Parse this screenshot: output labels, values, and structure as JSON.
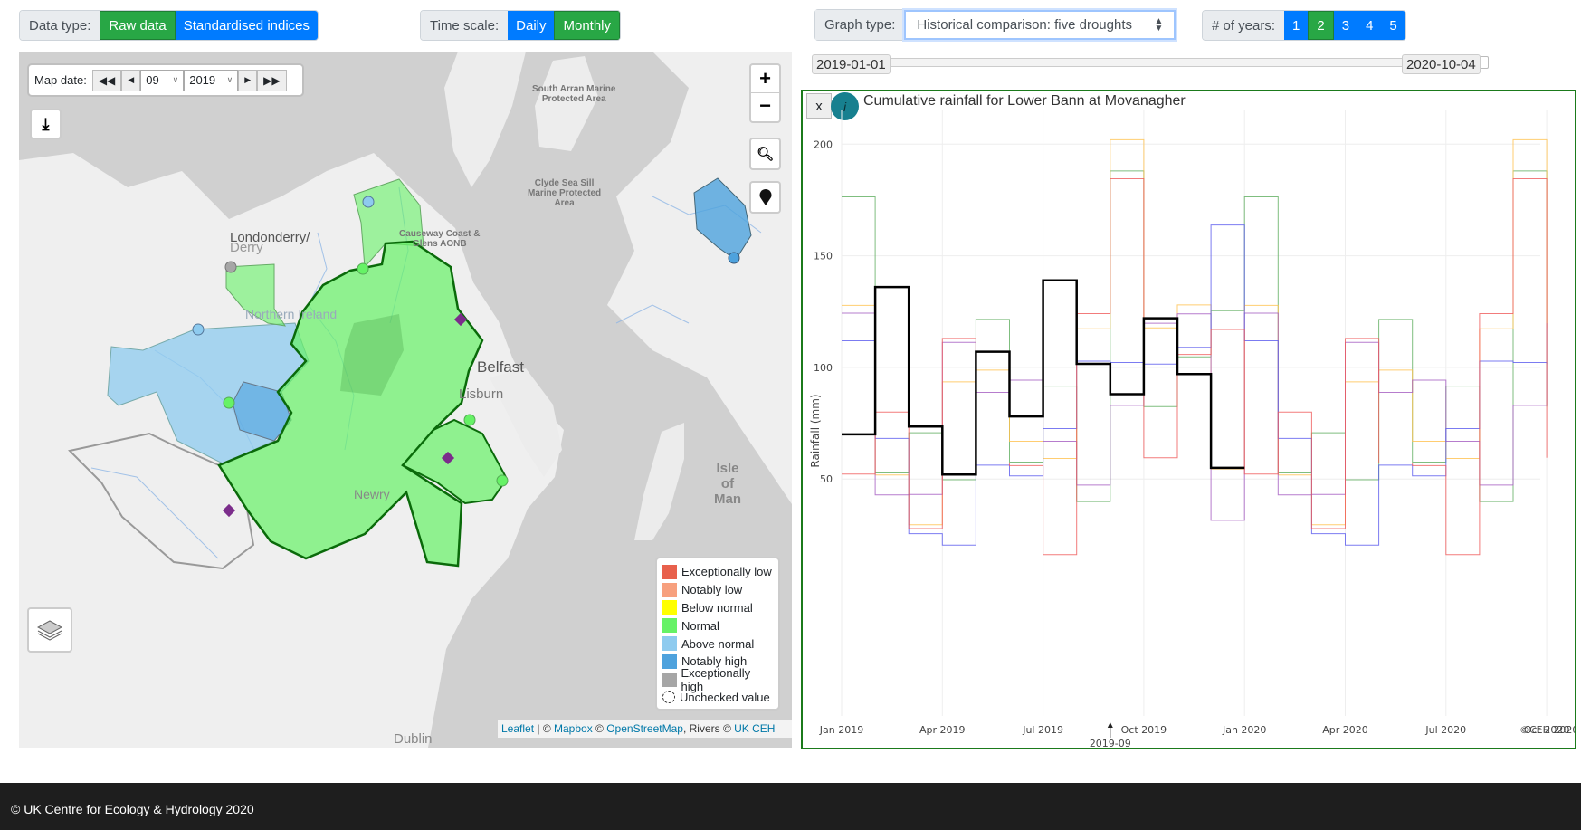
{
  "toolbar": {
    "data_type": {
      "label": "Data type:",
      "options": [
        "Raw data",
        "Standardised indices"
      ],
      "selected": "Raw data"
    },
    "time_scale": {
      "label": "Time scale:",
      "options": [
        "Daily",
        "Monthly"
      ],
      "selected": "Monthly"
    },
    "graph_type": {
      "label": "Graph type:",
      "value": "Historical comparison: five droughts"
    },
    "years": {
      "label": "# of years:",
      "options": [
        "1",
        "2",
        "3",
        "4",
        "5"
      ],
      "selected": "2"
    }
  },
  "slider": {
    "start": "2019-01-01",
    "end": "2020-10-04"
  },
  "map": {
    "date_label": "Map date:",
    "month": "09",
    "year": "2019",
    "place_labels": {
      "derry1": "Londonderry/",
      "derry2": "Derry",
      "belfast": "Belfast",
      "lisburn": "Lisburn",
      "newry": "Newry",
      "ni": "Northern Ireland",
      "aonb1": "Causeway Coast &",
      "aonb2": "Glens AONB",
      "iom1": "Isle",
      "iom2": "of",
      "iom3": "Man",
      "arran1": "South Arran Marine",
      "arran2": "Protected Area",
      "clyde1": "Clyde Sea Sill",
      "clyde2": "Marine Protected",
      "clyde3": "Area",
      "dublin": "Dublin"
    },
    "legend": [
      {
        "label": "Exceptionally low",
        "color": "#e8604c"
      },
      {
        "label": "Notably low",
        "color": "#f7a07e"
      },
      {
        "label": "Below normal",
        "color": "#ffff00"
      },
      {
        "label": "Normal",
        "color": "#66f266"
      },
      {
        "label": "Above normal",
        "color": "#8ecbef"
      },
      {
        "label": "Notably high",
        "color": "#4ea2dd"
      },
      {
        "label": "Exceptionally high",
        "color": "#a6a6a6"
      },
      {
        "label": "Unchecked value",
        "color": "none"
      }
    ],
    "attribution": {
      "leaflet": "Leaflet",
      "sep": " | © ",
      "mapbox": "Mapbox",
      "c2": " © ",
      "osm": "OpenStreetMap",
      "rivers": ", Rivers © ",
      "ceh": "UK CEH"
    }
  },
  "chart": {
    "close_label": "x",
    "info_label": "i",
    "title": "Cumulative rainfall for Lower Bann at Movanagher",
    "copyright": "©CEH 2020"
  },
  "chart_data": {
    "type": "line",
    "line_shape": "step (hv)",
    "title": "Cumulative rainfall for Lower Bann at Movanagher",
    "ylabel": "Rainfall (mm)",
    "ylim": [
      10,
      215
    ],
    "yticks": [
      50,
      100,
      150,
      200
    ],
    "x_start": "2019-01",
    "x_end": "2020-10",
    "xticks": [
      {
        "month": "2019-01",
        "label": "Jan 2019"
      },
      {
        "month": "2019-04",
        "label": "Apr 2019"
      },
      {
        "month": "2019-07",
        "label": "Jul 2019"
      },
      {
        "month": "2019-10",
        "label": "Oct 2019"
      },
      {
        "month": "2020-01",
        "label": "Jan 2020"
      },
      {
        "month": "2020-04",
        "label": "Apr 2020"
      },
      {
        "month": "2020-07",
        "label": "Jul 2020"
      },
      {
        "month": "2020-10",
        "label": "Oct 2020"
      }
    ],
    "annotation": {
      "month": "2019-09",
      "label": "2019-09"
    },
    "grid": true,
    "series": [
      {
        "color": "#000000",
        "width": 2.5,
        "values": [
          70,
          136,
          73.5,
          52,
          107,
          78,
          139,
          101.6,
          88,
          122,
          97,
          55
        ]
      },
      {
        "color": "#5fae5f",
        "values": [
          176.4,
          52.7,
          70.7,
          49.7,
          121.5,
          57.6,
          91.6,
          39.9,
          188,
          82.4,
          104.7,
          125.4,
          176.4,
          52.7,
          70.7,
          49.7,
          121.5,
          57.6,
          91.6,
          39.9,
          188,
          82.4
        ]
      },
      {
        "color": "#ffc04d",
        "values": [
          127.8,
          51.8,
          29.5,
          93.5,
          98.8,
          66.9,
          59.2,
          117.3,
          202,
          117.7,
          128,
          54.5,
          127.8,
          51.8,
          29.5,
          93.5,
          98.8,
          66.9,
          59.2,
          117.3,
          202,
          117.7
        ]
      },
      {
        "color": "#a45bc0",
        "values": [
          124.3,
          42.9,
          43.1,
          111.2,
          88.8,
          94.3,
          66.9,
          47.3,
          83,
          119.8,
          124,
          31.5,
          124.3,
          42.9,
          43.1,
          111.2,
          88.8,
          94.3,
          66.9,
          47.3,
          83,
          119.8
        ]
      },
      {
        "color": "#5a5aee",
        "values": [
          111.9,
          68.2,
          25.5,
          20.4,
          56.2,
          51.4,
          72.6,
          102.8,
          102.2,
          101.5,
          109,
          163.8,
          111.9,
          68.2,
          25.5,
          20.4,
          56.2,
          51.4,
          72.6,
          102.8,
          102.2,
          101.5
        ]
      },
      {
        "color": "#ef5a5a",
        "values": [
          52.2,
          80,
          27.8,
          113,
          57.2,
          56,
          16.1,
          124.1,
          184.5,
          59.5,
          105.8,
          117,
          52.2,
          80,
          27.8,
          113,
          57.2,
          56,
          16.1,
          124.1,
          184.5,
          59.5
        ]
      }
    ]
  },
  "footer": {
    "text": "© UK Centre for Ecology & Hydrology 2020"
  }
}
